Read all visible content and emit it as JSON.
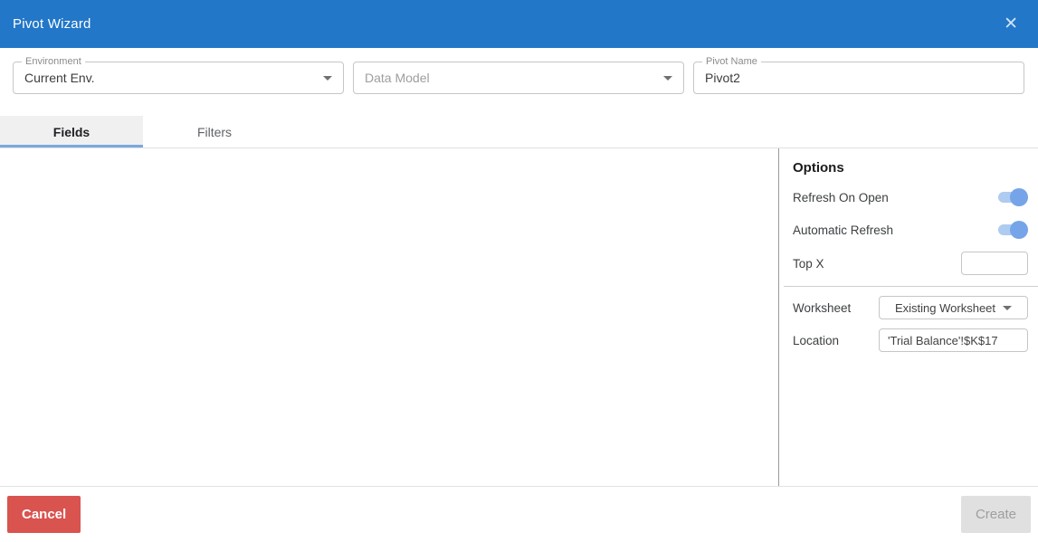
{
  "header": {
    "title": "Pivot Wizard",
    "close_icon": "close-icon"
  },
  "form": {
    "environment": {
      "label": "Environment",
      "value": "Current Env."
    },
    "data_model": {
      "placeholder": "Data Model"
    },
    "pivot_name": {
      "label": "Pivot Name",
      "value": "Pivot2"
    }
  },
  "tabs": [
    {
      "label": "Fields",
      "active": true
    },
    {
      "label": "Filters",
      "active": false
    }
  ],
  "options": {
    "heading": "Options",
    "toggles": [
      {
        "label": "Refresh On Open",
        "state": "on"
      },
      {
        "label": "Automatic Refresh",
        "state": "on"
      }
    ],
    "top_x": {
      "label": "Top X",
      "value": ""
    },
    "worksheet": {
      "label": "Worksheet",
      "value": "Existing Worksheet"
    },
    "location": {
      "label": "Location",
      "value": "'Trial Balance'!$K$17"
    }
  },
  "footer": {
    "cancel_label": "Cancel",
    "create_label": "Create"
  },
  "colors": {
    "header_blue": "#2277c8",
    "tab_underline_blue": "#7aa9dd",
    "cancel_red": "#d9534f",
    "toggle_track": "#aecbf0",
    "toggle_knob": "#76a4e8"
  }
}
